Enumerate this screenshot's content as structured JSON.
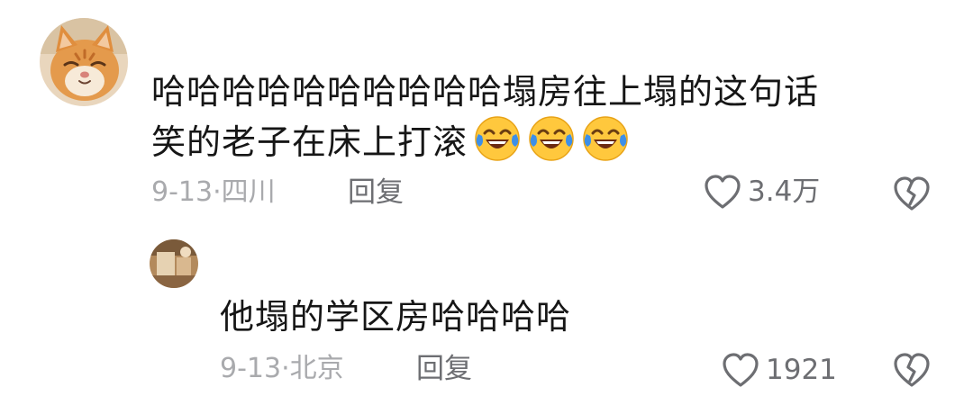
{
  "comment": {
    "line1": "哈哈哈哈哈哈哈哈哈哈塌房往上塌的这句话",
    "line2": "笑的老子在床上打滚",
    "emojis": [
      "laugh-cry-emoji",
      "laugh-cry-emoji",
      "laugh-cry-emoji"
    ],
    "date": "9-13",
    "separator": "·",
    "location": "四川",
    "reply_label": "回复",
    "likes": "3.4万",
    "icons": {
      "like": "heart-outline-icon",
      "dislike": "broken-heart-icon"
    },
    "avatar": "orange-cat-avatar"
  },
  "reply": {
    "text": "他塌的学区房哈哈哈哈",
    "date": "9-13",
    "separator": "·",
    "location": "北京",
    "reply_label": "回复",
    "likes": "1921",
    "icons": {
      "like": "heart-outline-icon",
      "dislike": "broken-heart-icon"
    },
    "avatar": "brown-photo-avatar"
  },
  "colors": {
    "text": "#161616",
    "meta": "#a9aaad",
    "action": "#6d6e72",
    "emoji_face": "#ffc83d",
    "emoji_tear": "#3d8fe8"
  }
}
